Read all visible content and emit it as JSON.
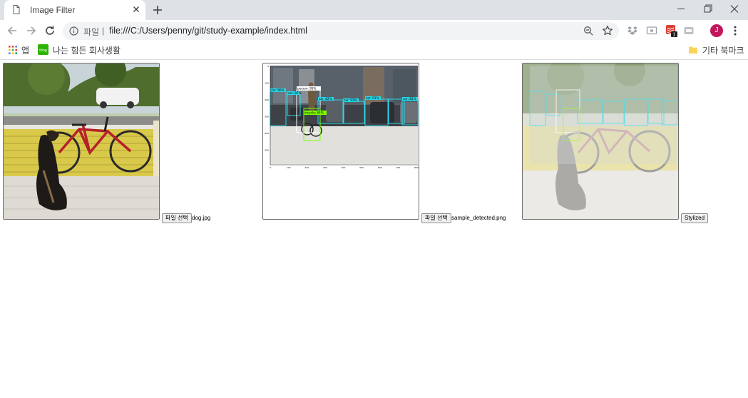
{
  "tab": {
    "title": "Image Filter",
    "new_tab_symbol": "+"
  },
  "window_controls": [
    "minimize-icon",
    "restore-icon",
    "close-icon"
  ],
  "omnibox": {
    "scheme_label": "파일",
    "separator": "|",
    "url": "file:///C:/Users/penny/git/study-example/index.html"
  },
  "extensions": {
    "badge_count": "1"
  },
  "profile": {
    "initial": "J",
    "color": "#c2185b"
  },
  "bookmarks": {
    "apps_label": "앱",
    "item_label": "나는 힘든 회사생활",
    "item_icon_text": "blog",
    "other_label": "기타 북마크"
  },
  "panels": [
    {
      "button_label": "파일 선택",
      "file_name": "dog.jpg"
    },
    {
      "button_label": "파일 선택",
      "file_name": "sample_detected.png",
      "detections": [
        "person: 95%",
        "bicycle: 65%",
        "car: 90%",
        "car: 87%",
        "car: 82%",
        "car: 93%",
        "car: 91%",
        "car: 85%"
      ],
      "x_ticks": [
        "0",
        "100",
        "200",
        "300",
        "400",
        "500",
        "600",
        "700",
        "800"
      ],
      "y_ticks": [
        "0",
        "100",
        "200",
        "300",
        "400",
        "500"
      ]
    },
    {
      "button_label": "Stylized"
    }
  ],
  "colors": {
    "chrome_frame": "#dee1e6",
    "omnibox_bg": "#f1f3f4",
    "detection_box": "#29d6e8",
    "detection_box_bicycle": "#7fff00"
  }
}
